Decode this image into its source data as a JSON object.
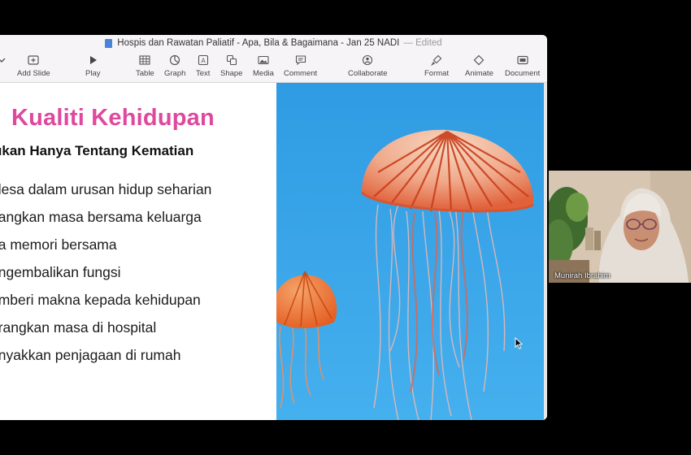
{
  "window": {
    "title": "Hospis dan Rawatan Paliatif - Apa, Bila & Bagaimana - Jan 25 NADI",
    "separator": "—",
    "status": "Edited"
  },
  "toolbar": {
    "items": [
      {
        "label": "Add Slide",
        "icon": "add-slide-icon"
      },
      {
        "label": "Play",
        "icon": "play-icon"
      },
      {
        "label": "Table",
        "icon": "table-icon"
      },
      {
        "label": "Graph",
        "icon": "graph-icon"
      },
      {
        "label": "Text",
        "icon": "text-icon"
      },
      {
        "label": "Shape",
        "icon": "shape-icon"
      },
      {
        "label": "Media",
        "icon": "media-icon"
      },
      {
        "label": "Comment",
        "icon": "comment-icon"
      },
      {
        "label": "Collaborate",
        "icon": "collaborate-icon"
      },
      {
        "label": "Format",
        "icon": "format-brush-icon"
      },
      {
        "label": "Animate",
        "icon": "animate-icon"
      },
      {
        "label": "Document",
        "icon": "document-icon"
      }
    ]
  },
  "slide": {
    "title": "Kualiti Kehidupan",
    "subtitle": "ukan Hanya Tentang Kematian",
    "bullets": [
      "elesa dalam urusan hidup seharian",
      "uangkan masa bersama keluarga",
      "na memori bersama",
      "engembalikan fungsi",
      "emberi makna kepada kehidupan",
      "urangkan masa di hospital",
      "anyakkan penjagaan di rumah"
    ],
    "image": "jellyfish-photo"
  },
  "video": {
    "participant_name": "Munirah Ibrahim"
  },
  "colors": {
    "title_pink": "#e0489d",
    "water_blue": "#3aa4e6",
    "jelly_orange": "#e8572a"
  }
}
